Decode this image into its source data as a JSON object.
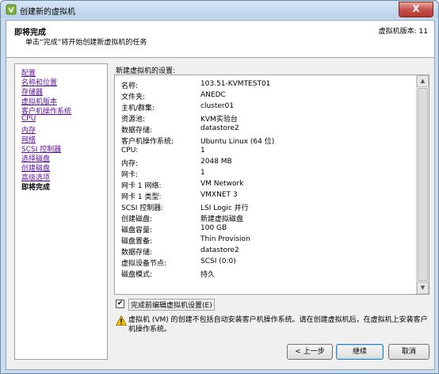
{
  "window": {
    "title": "创建新的虚拟机",
    "close_glyph": "X"
  },
  "header": {
    "title": "即将完成",
    "subtitle": "单击“完成”将开始创建新虚拟机的任务",
    "version": "虚拟机版本: 11"
  },
  "nav": {
    "items": [
      {
        "label": "配置"
      },
      {
        "label": "名称和位置"
      },
      {
        "label": "存储器"
      },
      {
        "label": "虚拟机版本"
      },
      {
        "label": "客户机操作系统"
      },
      {
        "label": "CPU"
      },
      {
        "label": "内存"
      },
      {
        "label": "网络"
      },
      {
        "label": "SCSI 控制器"
      },
      {
        "label": "选择磁盘"
      },
      {
        "label": "创建磁盘"
      },
      {
        "label": "高级选项"
      },
      {
        "label": "即将完成"
      }
    ]
  },
  "settings": {
    "label": "新建虚拟机的设置:",
    "rows": [
      {
        "key": "名称:",
        "value": "103.51-KVMTEST01"
      },
      {
        "key": "文件夹:",
        "value": "ANEDC"
      },
      {
        "key": "主机/群集:",
        "value": "cluster01"
      },
      {
        "key": "资源池:",
        "value": "KVM实验台"
      },
      {
        "key": "数据存储:",
        "value": "datastore2"
      },
      {
        "key": "客户机操作系统:",
        "value": "Ubuntu Linux (64 位)"
      },
      {
        "key": "CPU:",
        "value": "1"
      },
      {
        "key": "内存:",
        "value": "2048 MB"
      },
      {
        "key": "网卡:",
        "value": "1"
      },
      {
        "key": "网卡 1 网络:",
        "value": "VM Network"
      },
      {
        "key": "网卡 1 类型:",
        "value": "VMXNET 3"
      },
      {
        "key": "SCSI 控制器:",
        "value": "LSI Logic 并行"
      },
      {
        "key": "创建磁盘:",
        "value": "新建虚拟磁盘"
      },
      {
        "key": "磁盘容量:",
        "value": "100 GB"
      },
      {
        "key": "磁盘置备:",
        "value": "Thin Provision"
      },
      {
        "key": "数据存储:",
        "value": "datastore2"
      },
      {
        "key": "虚拟设备节点:",
        "value": "SCSI (0:0)"
      },
      {
        "key": "磁盘模式:",
        "value": "持久"
      }
    ]
  },
  "edit_settings": {
    "label": "完成前编辑虚拟机设置(E)",
    "checked_glyph": "✔"
  },
  "warning": {
    "text": "虚拟机 (VM) 的创建不包括自动安装客户机操作系统。请在创建虚拟机后，在虚拟机上安装客户机操作系统。"
  },
  "buttons": {
    "back": "< 上一步",
    "finish": "继续",
    "cancel": "取消"
  },
  "scrollbar": {
    "up": "▲",
    "down": "▼"
  }
}
